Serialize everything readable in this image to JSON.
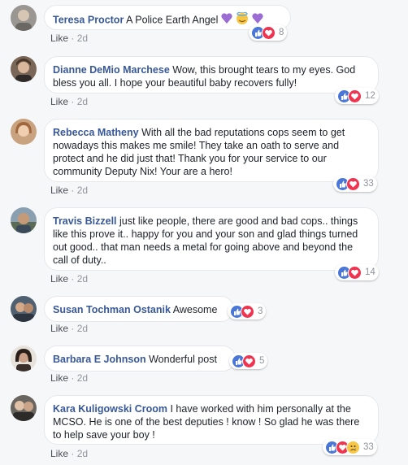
{
  "comments": [
    {
      "author": "Teresa Proctor",
      "text": "A Police Earth Angel",
      "like": "Like",
      "sep": "·",
      "time": "2d",
      "count": "8",
      "avatar_color": "#8c8a86"
    },
    {
      "author": "Dianne DeMio Marchese",
      "text": "Wow, this brought tears to my eyes. God bless you all. I hope your beautiful baby recovers fully!",
      "like": "Like",
      "sep": "·",
      "time": "2d",
      "count": "12",
      "avatar_color": "#6f5b4c"
    },
    {
      "author": "Rebecca Matheny",
      "text": "With all the bad reputations cops seem to get nowadays this makes me smile! They take an oath to serve and protect and he did just that! Thank you for your service to our community Deputy Nix! Your are a hero!",
      "like": "Like",
      "sep": "·",
      "time": "2d",
      "count": "33",
      "avatar_color": "#b48a6a"
    },
    {
      "author": "Travis Bizzell",
      "text": "just like people, there are good and bad cops.. things like this prove it.. happy for you and your son and glad things turned out good.. that man needs a metal for going above and beyond the call of duty..",
      "like": "Like",
      "sep": "·",
      "time": "2d",
      "count": "14",
      "avatar_color": "#6d7f8c"
    },
    {
      "author": "Susan Tochman Ostanik",
      "text": "Awesome",
      "like": "Like",
      "sep": "·",
      "time": "2d",
      "count": "3",
      "avatar_color": "#4b5a6a"
    },
    {
      "author": "Barbara E Johnson",
      "text": "Wonderful post",
      "like": "Like",
      "sep": "·",
      "time": "2d",
      "count": "5",
      "avatar_color": "#3c2f2a"
    },
    {
      "author": "Kara Kuligowski Croom",
      "text": "I have worked with him personally at the MCSO. He is one of the best deputies ! know ! So glad he was there to help save your boy !",
      "like": "Like",
      "sep": "·",
      "time": "2d",
      "count": "33",
      "avatar_color": "#55524e"
    }
  ],
  "colors": {
    "author": "#385898",
    "like_blue": "#4a76d8",
    "love_red": "#f0334f",
    "sad_yellow": "#f7c644",
    "heart_purple": "#9b6dd4"
  },
  "icons": {
    "like": "thumbs-up-icon",
    "love": "heart-icon",
    "sad": "sad-face-icon",
    "emoji": "purple-heart-angel-emoji"
  }
}
